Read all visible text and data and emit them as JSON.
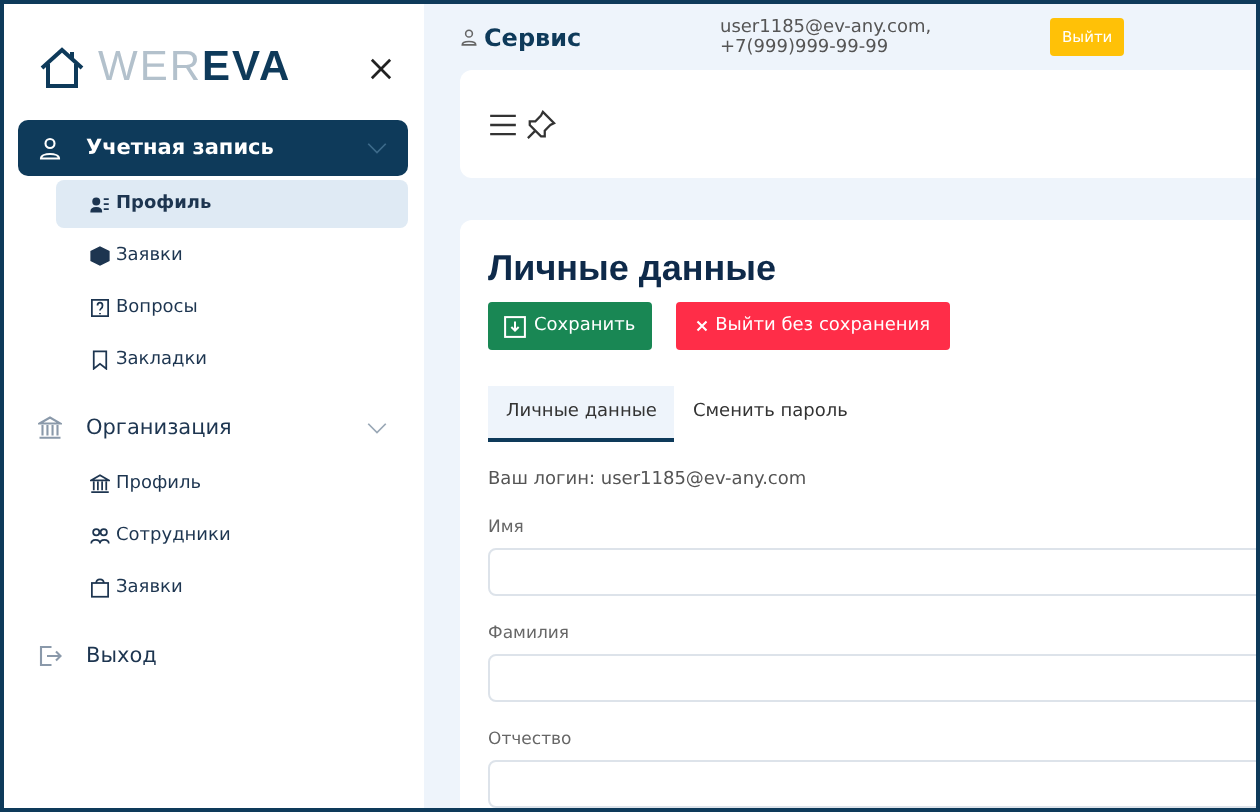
{
  "logo": {
    "light": "WER",
    "dark": "EVA"
  },
  "sidebar": {
    "groups": [
      {
        "label": "Учетная запись",
        "selected": true,
        "expanded": true,
        "items": [
          {
            "label": "Профиль",
            "selected": true
          },
          {
            "label": "Заявки",
            "selected": false
          },
          {
            "label": "Вопросы",
            "selected": false
          },
          {
            "label": "Закладки",
            "selected": false
          }
        ]
      },
      {
        "label": "Организация",
        "selected": false,
        "expanded": true,
        "items": [
          {
            "label": "Профиль",
            "selected": false
          },
          {
            "label": "Сотрудники",
            "selected": false
          },
          {
            "label": "Заявки",
            "selected": false
          }
        ]
      },
      {
        "label": "Выход",
        "selected": false
      }
    ]
  },
  "header": {
    "title": "Сервис",
    "contact": "user1185@ev-any.com, +7(999)999-99-99",
    "logout": "Выйти"
  },
  "page": {
    "title": "Личные данные",
    "save": "Сохранить",
    "discard": "Выйти без сохранения",
    "tabs": [
      {
        "label": "Личные данные",
        "selected": true
      },
      {
        "label": "Сменить пароль",
        "selected": false
      }
    ],
    "login": "Ваш логин: user1185@ev-any.com",
    "fields": [
      {
        "label": "Имя"
      },
      {
        "label": "Фамилия"
      },
      {
        "label": "Отчество"
      }
    ]
  }
}
